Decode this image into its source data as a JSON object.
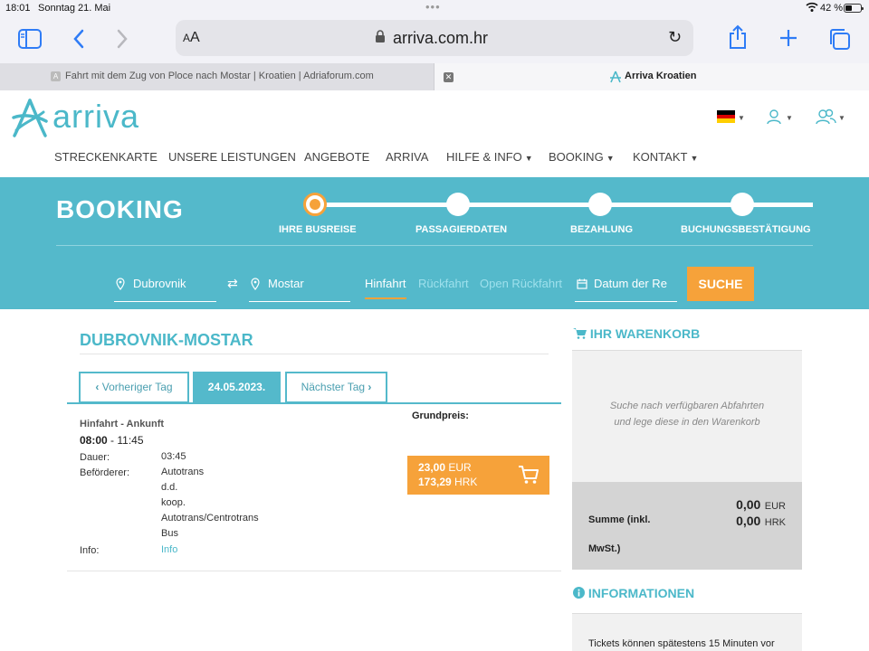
{
  "status": {
    "time": "18:01",
    "date": "Sonntag 21. Mai",
    "battery": "42 %",
    "battery_level": 0.42
  },
  "browser": {
    "url": "arriva.com.hr",
    "text_size_label": "AA",
    "tabs": [
      {
        "title": "Fahrt mit dem Zug von Ploce nach Mostar | Kroatien | Adriaforum.com",
        "favicon": "A"
      },
      {
        "title": "Arriva Kroatien"
      }
    ]
  },
  "site": {
    "logo_text": "arriva",
    "nav": [
      "STRECKENKARTE",
      "UNSERE LEISTUNGEN",
      "ANGEBOTE",
      "ARRIVA",
      "HILFE & INFO",
      "BOOKING",
      "KONTAKT"
    ],
    "language_flag": "de"
  },
  "booking": {
    "title": "BOOKING",
    "steps": [
      "IHRE BUSREISE",
      "PASSAGIERDATEN",
      "BEZAHLUNG",
      "BUCHUNGSBESTÄTIGUNG"
    ],
    "active_step": 0,
    "from": "Dubrovnik",
    "to": "Mostar",
    "trip_types": [
      "Hinfahrt",
      "Rückfahrt",
      "Open Rückfahrt"
    ],
    "date_placeholder": "Datum der Re",
    "search_label": "SUCHE"
  },
  "results": {
    "route_title": "DUBROVNIK-MOSTAR",
    "prev_day": "Vorheriger Tag",
    "current_date": "24.05.2023.",
    "next_day": "Nächster Tag",
    "depart_arrive_label": "Hinfahrt - Ankunft",
    "depart": "08:00",
    "arrive": "11:45",
    "time_sep": " - ",
    "duration_label": "Dauer:",
    "duration": "03:45",
    "carrier_label": "Beförderer:",
    "carrier_lines": [
      "Autotrans",
      "d.d.",
      "koop.",
      "Autotrans/Centrotrans",
      "Bus"
    ],
    "info_label": "Info:",
    "info_link": "Info",
    "base_price_label": "Grundpreis:",
    "price_eur": "23,00",
    "eur": "EUR",
    "price_hrk": "173,29",
    "hrk": "HRK"
  },
  "cart": {
    "title": "IHR WARENKORB",
    "empty_line1": "Suche nach verfügbaren Abfahrten",
    "empty_line2": "und lege diese in den Warenkorb",
    "sum_label_1": "Summe (inkl.",
    "sum_label_2": "MwSt.)",
    "sum_eur": "0,00",
    "sum_hrk": "0,00",
    "eur": "EUR",
    "hrk": "HRK"
  },
  "info": {
    "title": "INFORMATIONEN",
    "text": "Tickets können spätestens 15 Minuten vor"
  },
  "colors": {
    "teal": "#54b9cb",
    "orange": "#f6a23a",
    "ios_blue": "#2f7cf6"
  }
}
